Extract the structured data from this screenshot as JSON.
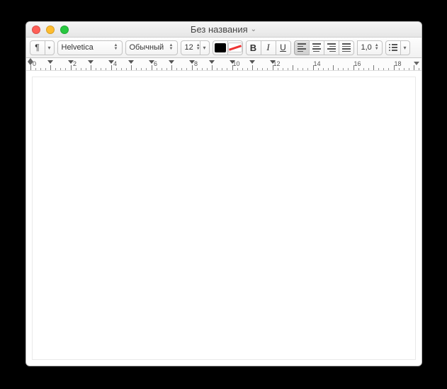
{
  "window": {
    "title": "Без названия"
  },
  "toolbar": {
    "paragraph_symbol": "¶",
    "font_family": "Helvetica",
    "font_style": "Обычный",
    "font_size": "12",
    "bold_label": "B",
    "italic_label": "I",
    "underline_label": "U",
    "line_spacing": "1,0"
  },
  "ruler": {
    "unit_spacing_px": 28.5,
    "labels": [
      "0",
      "2",
      "4",
      "6",
      "8",
      "10",
      "12",
      "14",
      "16",
      "18"
    ],
    "label_interval": 2,
    "tab_stops": [
      1,
      2,
      3,
      4,
      5,
      6,
      7,
      8,
      9,
      10,
      11,
      12
    ]
  }
}
